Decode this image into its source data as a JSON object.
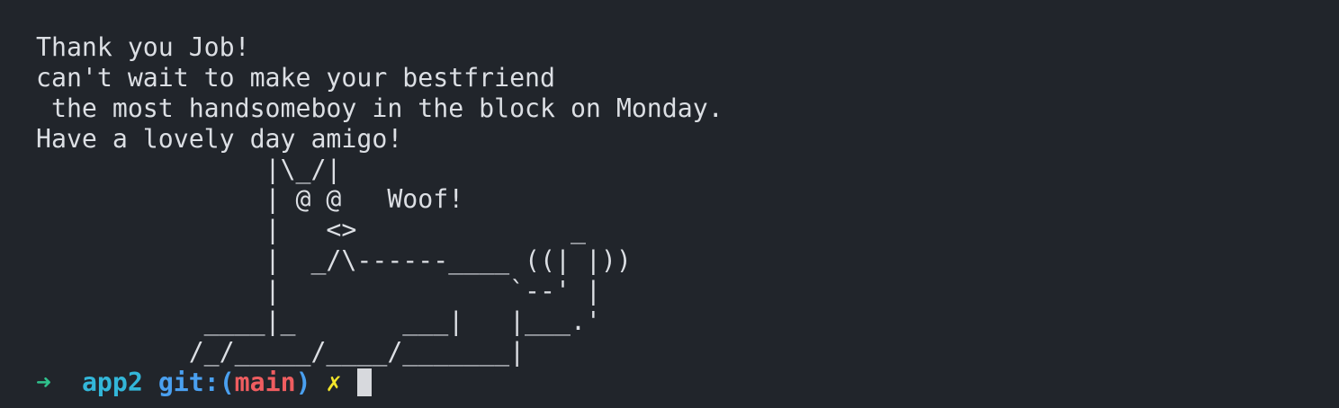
{
  "terminal": {
    "output_lines": [
      "Thank you Job!",
      "can't wait to make your bestfriend",
      " the most handsomeboy in the block on Monday.",
      "Have a lovely day amigo!",
      "               |\\_/|",
      "               | @ @   Woof!",
      "               |   <>              _",
      "               |  _/\\------____ ((| |))",
      "               |               `--' |",
      "           ____|_       ___|   |___.'",
      "          /_/_____/____/_______|"
    ],
    "prompt": {
      "arrow": "➜",
      "directory": "app2",
      "git_label": "git:(",
      "branch": "main",
      "git_close": ")",
      "dirty_marker": "✗"
    }
  }
}
